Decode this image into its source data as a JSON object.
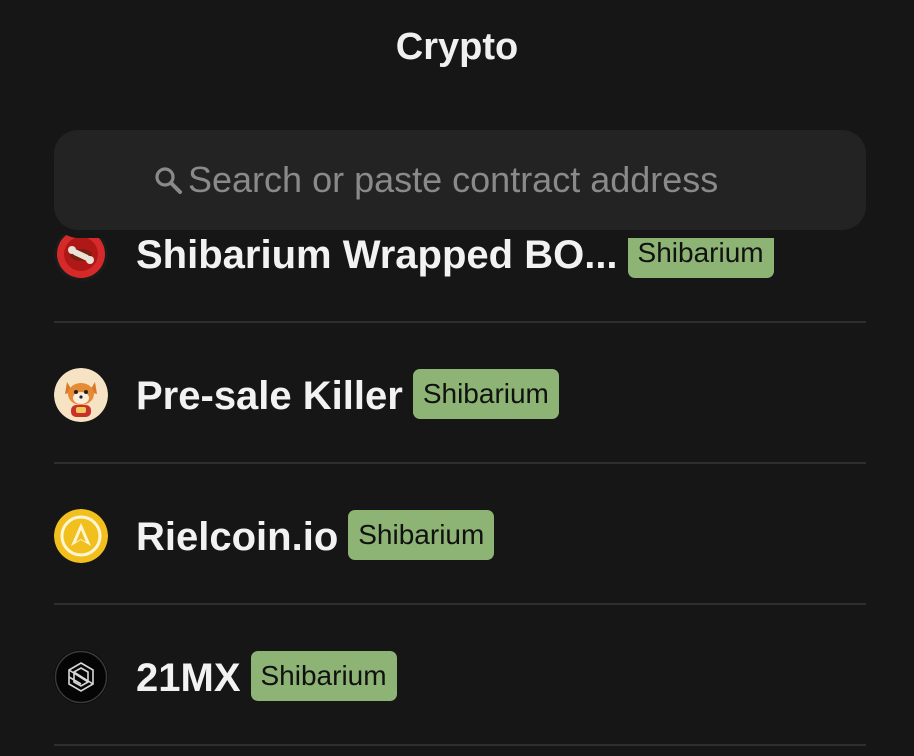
{
  "header": {
    "title": "Crypto"
  },
  "search": {
    "placeholder": "Search or paste contract address",
    "value": ""
  },
  "tokens": [
    {
      "name": "Shibarium Wrapped BO...",
      "network": "Shibarium",
      "icon": "bone-icon"
    },
    {
      "name": "Pre-sale Killer",
      "network": "Shibarium",
      "icon": "shiba-avatar-icon"
    },
    {
      "name": "Rielcoin.io",
      "network": "Shibarium",
      "icon": "rielcoin-icon"
    },
    {
      "name": "21MX",
      "network": "Shibarium",
      "icon": "21mx-icon"
    }
  ],
  "colors": {
    "background": "#161616",
    "search_bg": "#232323",
    "badge_bg": "#8db474",
    "divider": "#2e2e2e"
  }
}
